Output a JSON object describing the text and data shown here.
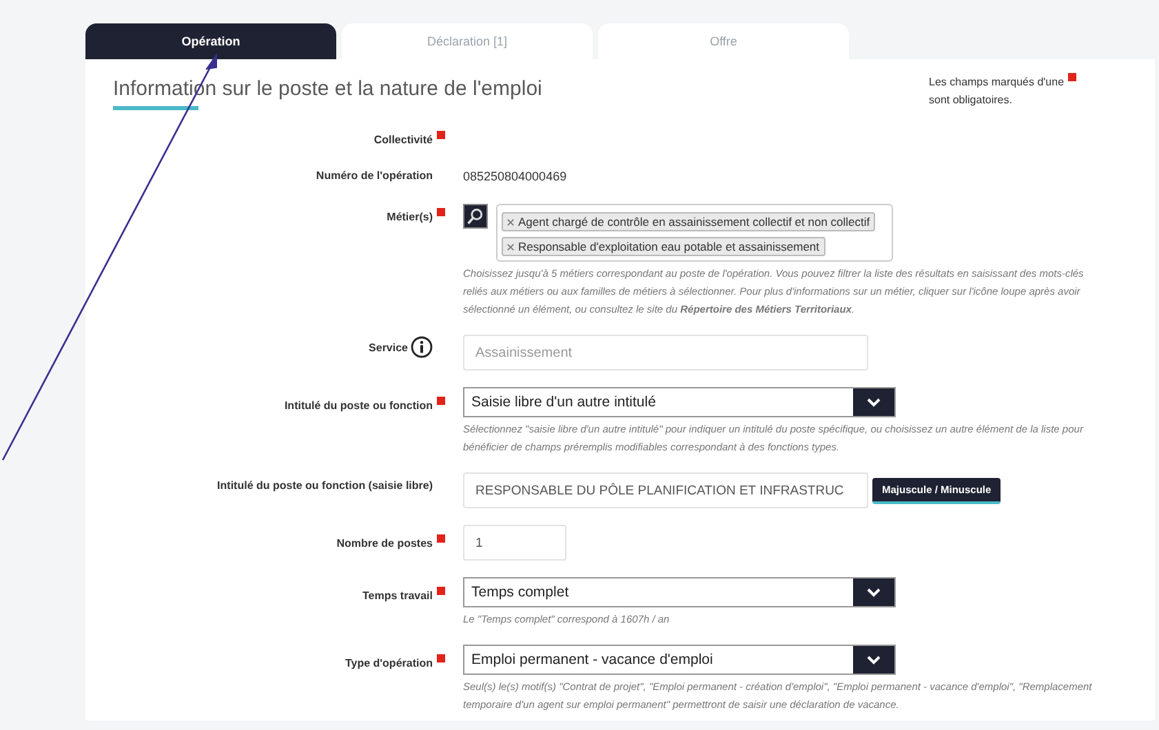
{
  "tabs": [
    {
      "label": "Opération",
      "selected": true
    },
    {
      "label": "Déclaration [1]",
      "selected": false
    },
    {
      "label": "Offre",
      "selected": false
    }
  ],
  "section": {
    "title": "Information sur le poste et la nature de l'emploi",
    "required_note": "Les champs marqués d'une",
    "required_note_end": "sont obligatoires."
  },
  "fields": [
    {
      "kind": "static",
      "label": "Collectivité",
      "required": true
    },
    {
      "kind": "static",
      "label": "Numéro de l'opération",
      "required": false,
      "value": "085250804000469"
    },
    {
      "kind": "tags",
      "label": "Métier(s)",
      "required": true,
      "tags": [
        "Agent chargé de contrôle en assainissement collectif et non collectif",
        "Responsable d'exploitation eau potable et assainissement"
      ],
      "hint": "Choisissez jusqu'à 5 métiers correspondant au poste de l'opération. Vous pouvez filtrer la liste des résultats en saisissant des mots-clés reliés aux métiers ou aux familles de métiers à sélectionner. Pour plus d'informations sur un métier, cliquer sur l'icône loupe après avoir sélectionné un élément, ou consultez le site du **Répertoire des Métiers Territoriaux**."
    },
    {
      "kind": "input",
      "label": "Service",
      "required": false,
      "info": true,
      "placeholder": "Assainissement"
    },
    {
      "kind": "select",
      "label": "Intitulé du poste ou fonction",
      "required": true,
      "value": "Saisie libre d'un autre intitulé",
      "hint": "Sélectionnez \"saisie libre d'un autre intitulé\" pour indiquer un intitulé du poste spécifique, ou choisissez un autre élément de la liste pour bénéficier de champs préremplis modifiables correspondant à des fonctions types."
    },
    {
      "kind": "input",
      "label": "Intitulé du poste ou fonction (saisie libre)",
      "required": false,
      "value": "RESPONSABLE DU PÔLE PLANIFICATION ET INFRASTRUC",
      "button": "Majuscule / Minuscule"
    },
    {
      "kind": "number",
      "label": "Nombre de postes",
      "required": true,
      "value": "1"
    },
    {
      "kind": "select",
      "label": "Temps travail",
      "required": true,
      "value": "Temps complet",
      "hint": "Le \"Temps complet\" correspond à 1607h / an"
    },
    {
      "kind": "select",
      "label": "Type d'opération",
      "required": true,
      "value": "Emploi permanent - vacance d'emploi",
      "hint": "Seul(s) le(s) motif(s) \"Contrat de projet\", \"Emploi permanent - création d'emploi\", \"Emploi permanent - vacance d'emploi\", \"Remplacement temporaire d'un agent sur emploi permanent\" permettront de saisir une déclaration de vacance."
    }
  ]
}
